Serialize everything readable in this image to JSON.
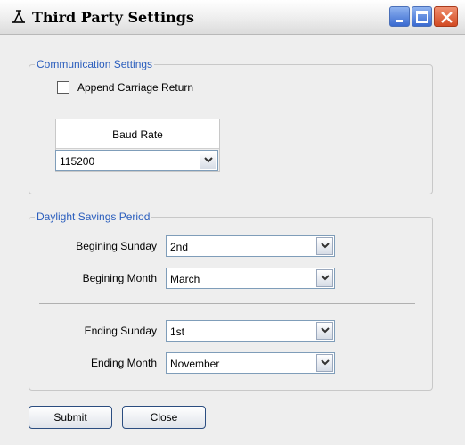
{
  "window": {
    "title": "Third Party Settings",
    "app_icon": "tuning-fork-icon",
    "controls": [
      "minimize-icon",
      "maximize-icon",
      "close-icon"
    ]
  },
  "communication": {
    "group_title": "Communication Settings",
    "append_carriage_return": {
      "label": "Append Carriage Return",
      "checked": false
    },
    "baud_rate": {
      "header": "Baud Rate",
      "value": "115200"
    }
  },
  "daylight": {
    "group_title": "Daylight Savings Period",
    "beginning_sunday": {
      "label": "Begining Sunday",
      "value": "2nd"
    },
    "beginning_month": {
      "label": "Begining Month",
      "value": "March"
    },
    "ending_sunday": {
      "label": "Ending Sunday",
      "value": "1st"
    },
    "ending_month": {
      "label": "Ending Month",
      "value": "November"
    }
  },
  "buttons": {
    "submit": "Submit",
    "close": "Close"
  },
  "colors": {
    "group_title": "#2b5ebd",
    "window_bg": "#eeeeee",
    "close_button": "#d24a22",
    "title_button": "#3a6ad0"
  }
}
